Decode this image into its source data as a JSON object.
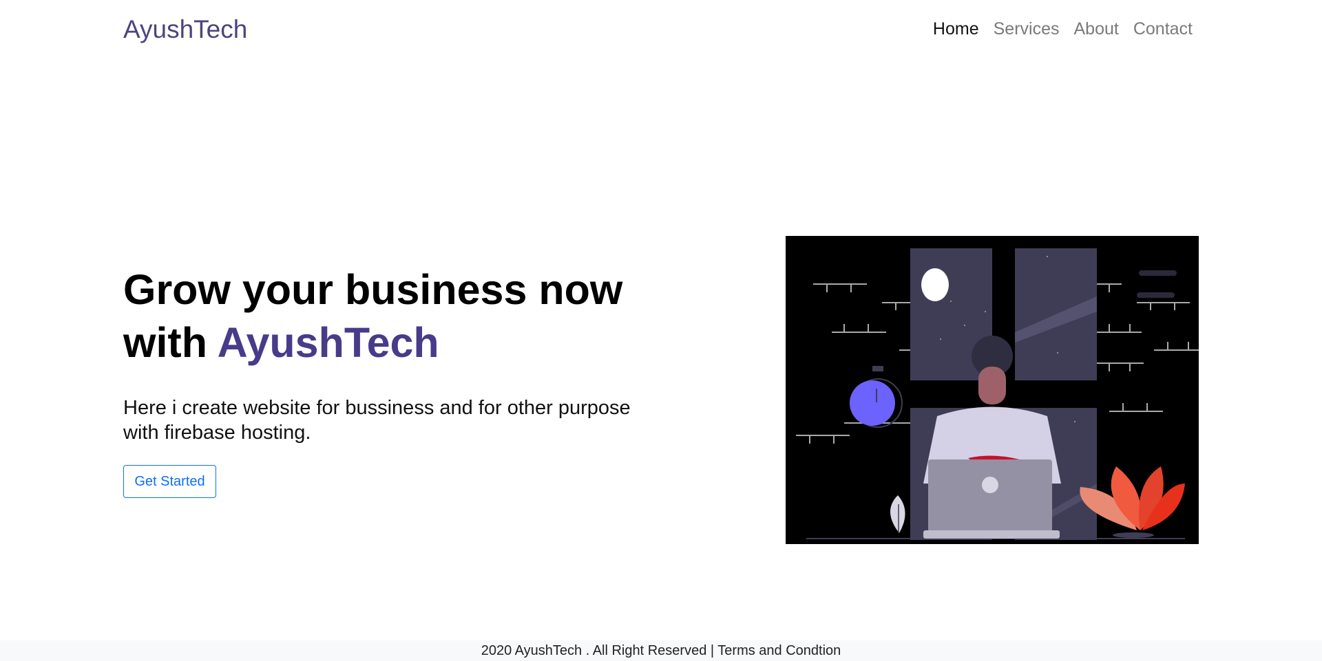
{
  "nav": {
    "brand": "AyushTech",
    "links": [
      {
        "label": "Home",
        "active": true
      },
      {
        "label": "Services",
        "active": false
      },
      {
        "label": "About",
        "active": false
      },
      {
        "label": "Contact",
        "active": false
      }
    ]
  },
  "hero": {
    "headline_line1": "Grow your business now",
    "headline_prefix": "with",
    "headline_brand": "AyushTech",
    "lead_line1": "Here i create website for bussiness and for other purpose",
    "lead_line2": "with firebase hosting.",
    "cta_label": "Get Started"
  },
  "footer": {
    "text": "2020 AyushTech . All Right Reserved |",
    "terms_link": "Terms and Condtion"
  },
  "colors": {
    "brand": "#4e447c",
    "accent": "#473b8a",
    "button": "#0d6efd",
    "footer_bg": "#f8f9fa"
  }
}
